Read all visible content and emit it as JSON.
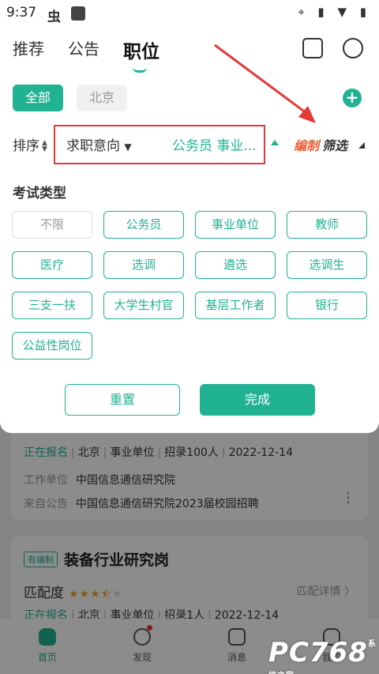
{
  "status": {
    "time": "9:37",
    "app_icon": "虫",
    "right_icons": "⌖ ▮ ▼ ▮"
  },
  "nav": {
    "tabs": [
      "推荐",
      "公告",
      "职位"
    ],
    "icons": [
      "briefcase-icon",
      "search-icon"
    ]
  },
  "cities": {
    "all": "全部",
    "beijing": "北京",
    "add": "+"
  },
  "filter": {
    "sort_label": "排序",
    "intent_label": "求职意向",
    "intent_value": "公务员 事业...",
    "bianzhi": "编制",
    "shaixuan": "筛选"
  },
  "exam": {
    "title": "考试类型",
    "options": [
      "不限",
      "公务员",
      "事业单位",
      "教师",
      "医疗",
      "选调",
      "遴选",
      "选调生",
      "三支一扶",
      "大学生村官",
      "基层工作者",
      "银行",
      "公益性岗位"
    ]
  },
  "actions": {
    "reset": "重置",
    "done": "完成"
  },
  "jobs": [
    {
      "status": "正在报名",
      "location": "北京",
      "category": "事业单位",
      "quota": "招录100人",
      "date": "2022-12-14",
      "employer_label": "工作单位",
      "employer": "中国信息通信研究院",
      "source_label": "来自公告",
      "source": "中国信息通信研究院2023届校园招聘"
    },
    {
      "tag": "有编制",
      "title": "装备行业研究岗",
      "match_label": "匹配度",
      "match_stars": 3.5,
      "match_detail": "匹配详情 〉",
      "status": "正在报名",
      "location": "北京",
      "category": "事业单位",
      "quota": "招录1人",
      "date": "2022-12-14"
    }
  ],
  "tabbar": [
    "首页",
    "发现",
    "消息",
    "我的"
  ],
  "watermark": {
    "text": "PC768",
    "sub": "系统之家"
  },
  "colors": {
    "accent": "#21b293",
    "highlight": "#e53935",
    "orange": "#ef5a2f"
  }
}
